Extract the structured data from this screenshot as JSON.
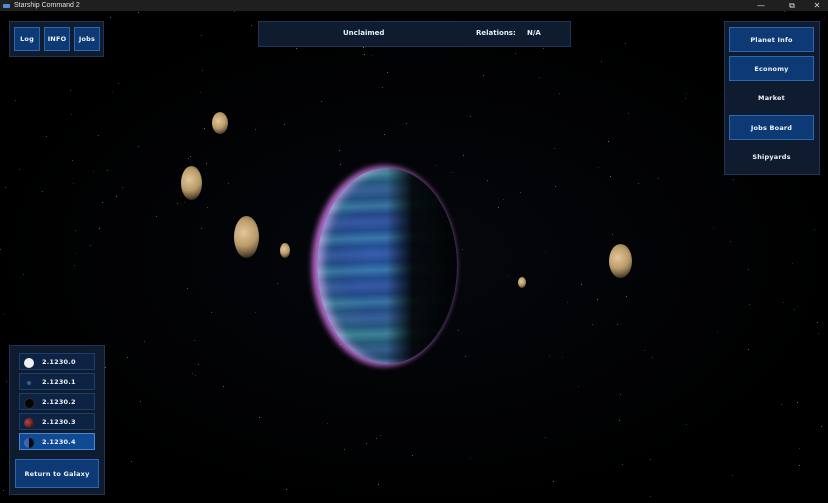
{
  "window": {
    "title": "Starship Command 2",
    "minimize_glyph": "—",
    "restore_glyph": "⧉",
    "close_glyph": "✕"
  },
  "top_nav": {
    "log_label": "Log",
    "info_label": "INFO",
    "jobs_label": "Jobs"
  },
  "status_bar": {
    "owner": "Unclaimed",
    "relations_label": "Relations:",
    "relations_value": "N/A"
  },
  "right_menu": {
    "items": [
      {
        "label": "Planet Info",
        "style": "button"
      },
      {
        "label": "Economy",
        "style": "button"
      },
      {
        "label": "Market",
        "style": "flat"
      },
      {
        "label": "Jobs Board",
        "style": "button"
      },
      {
        "label": "Shipyards",
        "style": "flat"
      }
    ]
  },
  "body_list": {
    "items": [
      {
        "name": "2.1230.0",
        "icon": "full-moon-icon"
      },
      {
        "name": "2.1230.1",
        "icon": "tiny-moon-icon"
      },
      {
        "name": "2.1230.2",
        "icon": "dark-moon-icon"
      },
      {
        "name": "2.1230.3",
        "icon": "red-planet-icon"
      },
      {
        "name": "2.1230.4",
        "icon": "half-planet-icon"
      }
    ],
    "selected_index": 4
  },
  "return_button_label": "Return to Galaxy",
  "colors": {
    "panel_bg": "#0f1c2f",
    "button_bg": "#0d3a75",
    "button_border": "#2e66b0",
    "atmosphere_glow": "#d778eb"
  }
}
